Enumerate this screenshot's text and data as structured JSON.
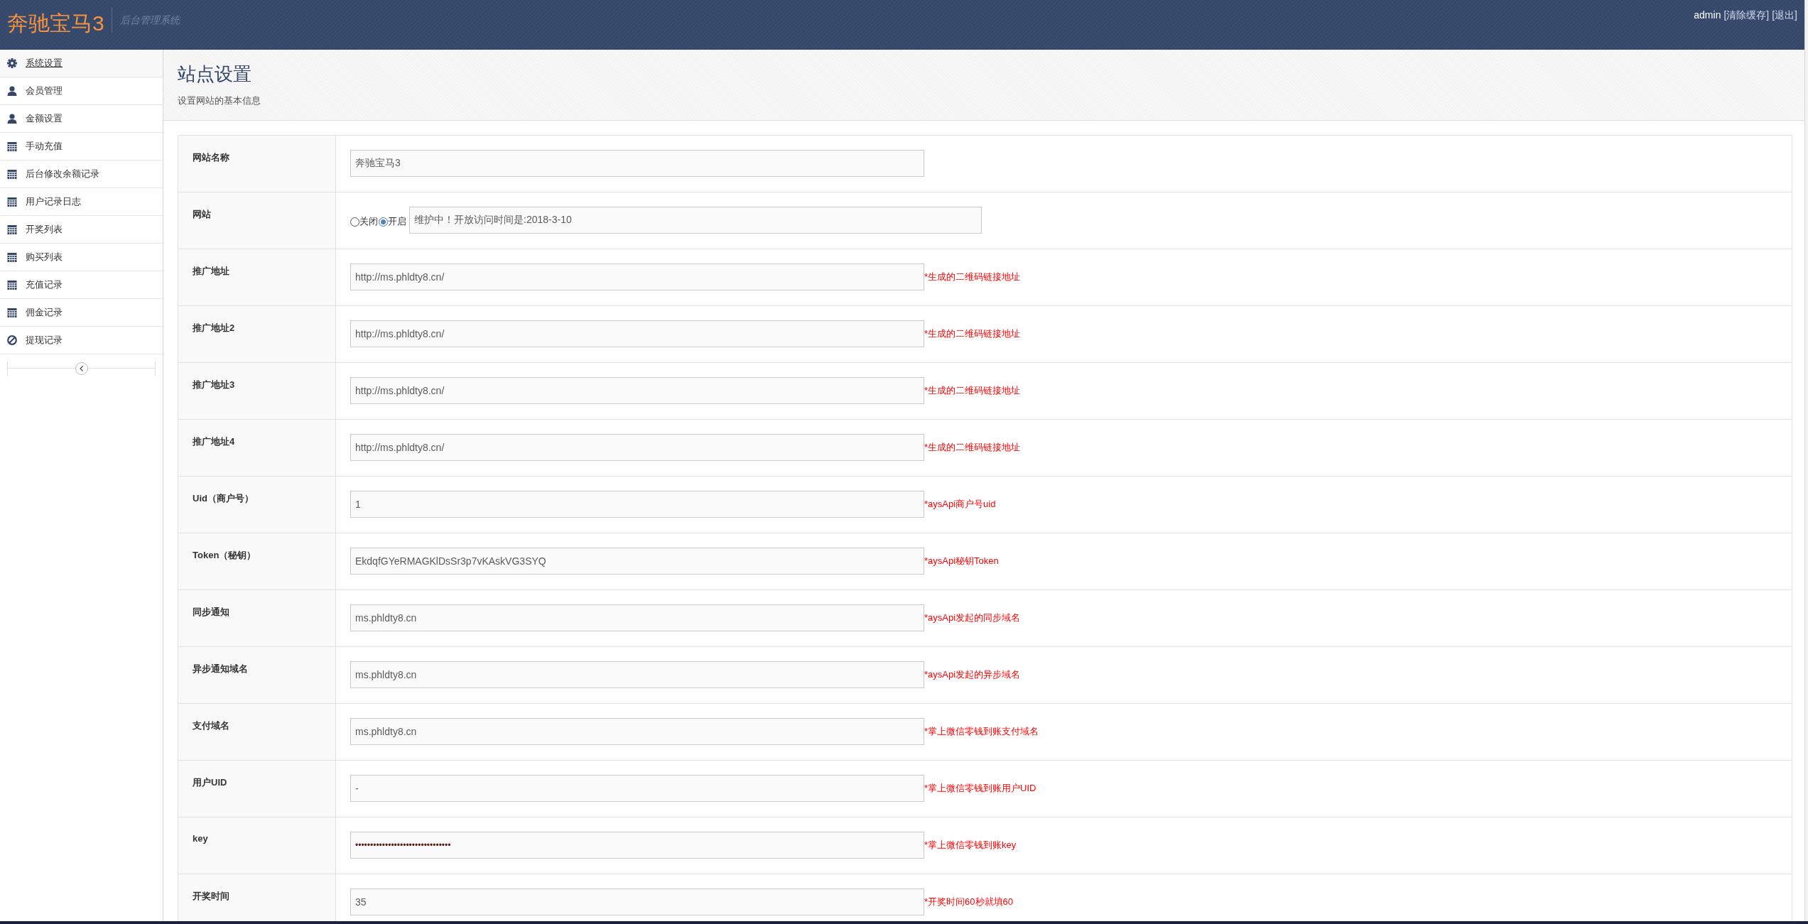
{
  "header": {
    "logo": "奔驰宝马3",
    "subtitle": "后台管理系统",
    "user": "admin",
    "links": [
      "[清除缓存]",
      "[退出]"
    ]
  },
  "sidebar": {
    "items": [
      {
        "label": "系统设置",
        "kind": "settings",
        "selected": true
      },
      {
        "label": "会员管理",
        "kind": "person",
        "selected": false
      },
      {
        "label": "金额设置",
        "kind": "person",
        "selected": false
      },
      {
        "label": "手动充值",
        "kind": "calendar",
        "selected": false
      },
      {
        "label": "后台修改余额记录",
        "kind": "calendar",
        "selected": false
      },
      {
        "label": "用户记录日志",
        "kind": "calendar",
        "selected": false
      },
      {
        "label": "开奖列表",
        "kind": "calendar",
        "selected": false
      },
      {
        "label": "购买列表",
        "kind": "calendar",
        "selected": false
      },
      {
        "label": "充值记录",
        "kind": "calendar",
        "selected": false
      },
      {
        "label": "佣金记录",
        "kind": "calendar",
        "selected": false
      },
      {
        "label": "提现记录",
        "kind": "blocked",
        "selected": false
      }
    ]
  },
  "page": {
    "title": "站点设置",
    "subtitle": "设置网站的基本信息"
  },
  "form": {
    "rows": [
      {
        "kind": "text",
        "label": "网站名称",
        "value": "奔驰宝马3"
      },
      {
        "kind": "radio_text",
        "label": "网站",
        "options": [
          {
            "label": "关闭",
            "selected": false
          },
          {
            "label": "开启",
            "selected": true
          }
        ],
        "value": "维护中！开放访问时间是:2018-3-10"
      },
      {
        "kind": "text",
        "label": "推广地址",
        "value": "http://ms.phldty8.cn/",
        "hint": "*生成的二维码链接地址"
      },
      {
        "kind": "text",
        "label": "推广地址2",
        "value": "http://ms.phldty8.cn/",
        "hint": "*生成的二维码链接地址"
      },
      {
        "kind": "text",
        "label": "推广地址3",
        "value": "http://ms.phldty8.cn/",
        "hint": "*生成的二维码链接地址"
      },
      {
        "kind": "text",
        "label": "推广地址4",
        "value": "http://ms.phldty8.cn/",
        "hint": "*生成的二维码链接地址"
      },
      {
        "kind": "text",
        "label": "Uid（商户号）",
        "value": "1",
        "hint": "*aysApi商户号uid"
      },
      {
        "kind": "text",
        "label": "Token（秘钥）",
        "value": "EkdqfGYeRMAGKlDsSr3p7vKAskVG3SYQ",
        "hint": "*aysApi秘钥Token"
      },
      {
        "kind": "text",
        "label": "同步通知",
        "value": "ms.phldty8.cn",
        "hint": "*aysApi发起的同步域名"
      },
      {
        "kind": "text",
        "label": "异步通知域名",
        "value": "ms.phldty8.cn",
        "hint": "*aysApi发起的异步域名"
      },
      {
        "kind": "text",
        "label": "支付域名",
        "value": "ms.phldty8.cn",
        "hint": "*掌上微信零钱到账支付域名"
      },
      {
        "kind": "text",
        "label": "用户UID",
        "value": "-",
        "hint": "*掌上微信零钱到账用户UID"
      },
      {
        "kind": "password",
        "label": "key",
        "value": "••••••••••••••••••••••••••••••••",
        "hint": "*掌上微信零钱到账key"
      },
      {
        "kind": "text",
        "label": "开奖时间",
        "value": "35",
        "hint": "*开奖时间60秒就填60"
      }
    ]
  }
}
